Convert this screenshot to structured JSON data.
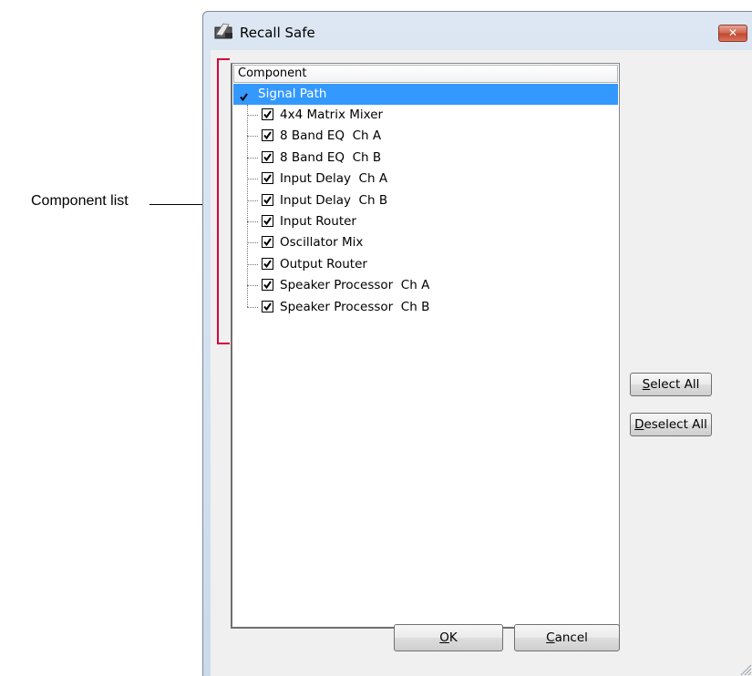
{
  "annotation": {
    "label": "Component list"
  },
  "window": {
    "title": "Recall Safe",
    "close_glyph": "✕"
  },
  "tree": {
    "column_header": "Component",
    "root": {
      "label": "Signal Path",
      "checked": true,
      "selected": true
    },
    "items": [
      {
        "label": "4x4 Matrix Mixer",
        "checked": true
      },
      {
        "label": "8 Band EQ  Ch A",
        "checked": true
      },
      {
        "label": "8 Band EQ  Ch B",
        "checked": true
      },
      {
        "label": "Input Delay  Ch A",
        "checked": true
      },
      {
        "label": "Input Delay  Ch B",
        "checked": true
      },
      {
        "label": "Input Router",
        "checked": true
      },
      {
        "label": "Oscillator Mix",
        "checked": true
      },
      {
        "label": "Output Router",
        "checked": true
      },
      {
        "label": "Speaker Processor  Ch A",
        "checked": true
      },
      {
        "label": "Speaker Processor  Ch B",
        "checked": true
      }
    ]
  },
  "buttons": {
    "select_all": {
      "mnemonic": "S",
      "rest": "elect All"
    },
    "deselect_all": {
      "mnemonic": "D",
      "rest": "eselect All"
    },
    "ok": {
      "mnemonic": "O",
      "rest": "K"
    },
    "cancel": {
      "mnemonic": "C",
      "rest": "ancel"
    }
  },
  "colors": {
    "selection": "#3399ff",
    "annotation_bracket": "#d4003a"
  }
}
